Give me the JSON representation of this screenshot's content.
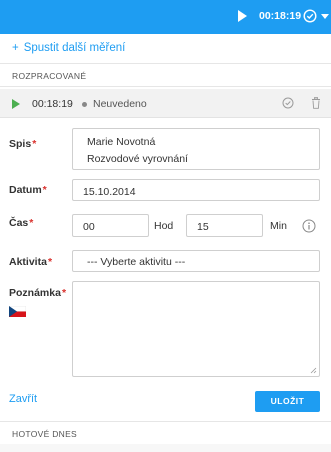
{
  "topbar": {
    "time": "00:18:19",
    "bg_color": "#1e9df2"
  },
  "actions": {
    "new_measure": "Spustit další měření"
  },
  "sections": {
    "in_progress": "ROZPRACOVANÉ",
    "done_today": "HOTOVÉ DNES"
  },
  "timer_row": {
    "time": "00:18:19",
    "status": "Neuvedeno"
  },
  "form": {
    "spis_label": "Spis",
    "spis_lines": [
      "Marie Novotná",
      "Rozvodové vyrovnání"
    ],
    "datum_label": "Datum",
    "datum_value": "15.10.2014",
    "cas_label": "Čas",
    "hours_value": "00",
    "hours_unit": "Hod",
    "minutes_value": "15",
    "minutes_unit": "Min",
    "aktivita_label": "Aktivita",
    "aktivita_value": "--- Vyberte aktivitu ---",
    "poznamka_label": "Poznámka",
    "required_mark": "*",
    "close_label": "Zavřít",
    "save_label": "ULOŽIT"
  },
  "icons": {
    "play": "play-icon",
    "check": "check-circle-icon",
    "caret": "chevron-down-icon",
    "trash": "trash-icon",
    "info": "info-icon",
    "flag": "czech-flag-icon"
  }
}
